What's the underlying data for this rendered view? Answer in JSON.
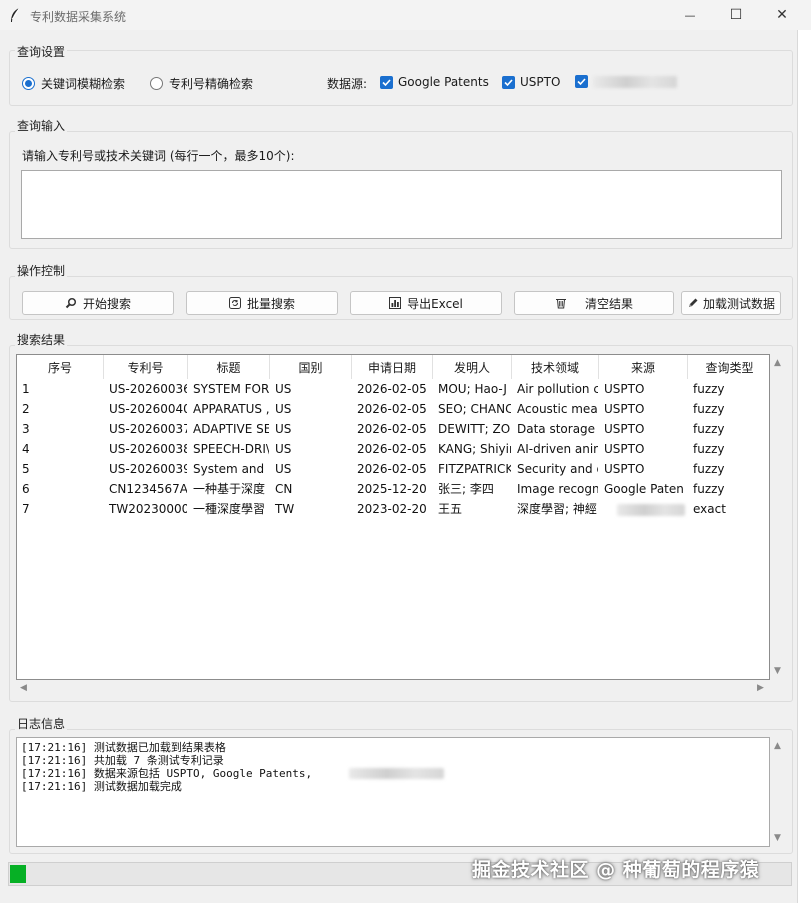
{
  "window": {
    "title": "专利数据采集系统",
    "minimize_glyph": "—",
    "maximize_glyph": "☐",
    "close_glyph": "✕"
  },
  "query_settings": {
    "legend": "查询设置",
    "mode_fuzzy": "关键词模糊检索",
    "mode_exact": "专利号精确检索",
    "selected_mode": "fuzzy",
    "sources_label": "数据源:",
    "sources": [
      {
        "label": "Google Patents",
        "checked": true
      },
      {
        "label": "USPTO",
        "checked": true
      },
      {
        "label": "",
        "checked": true,
        "redacted": true
      }
    ]
  },
  "query_input": {
    "legend": "查询输入",
    "prompt": "请输入专利号或技术关键词 (每行一个，最多10个):",
    "value": ""
  },
  "controls": {
    "legend": "操作控制",
    "buttons": [
      {
        "label": "开始搜索",
        "icon": "search-icon"
      },
      {
        "label": "批量搜索",
        "icon": "refresh-icon"
      },
      {
        "label": "导出Excel",
        "icon": "chart-icon"
      },
      {
        "label": "清空结果",
        "icon": "trash-icon"
      },
      {
        "label": "加载测试数据",
        "icon": "pencil-icon"
      }
    ]
  },
  "results": {
    "legend": "搜索结果",
    "columns": [
      "序号",
      "专利号",
      "标题",
      "国别",
      "申请日期",
      "发明人",
      "技术领域",
      "来源",
      "查询类型"
    ],
    "rows": [
      [
        "1",
        "US-20260036",
        "SYSTEM FOR",
        "US",
        "2026-02-05",
        "MOU; Hao-J",
        "Air pollution c",
        "USPTO",
        "fuzzy"
      ],
      [
        "2",
        "US-20260040",
        "APPARATUS ,",
        "US",
        "2026-02-05",
        "SEO; CHANC",
        "Acoustic meas",
        "USPTO",
        "fuzzy"
      ],
      [
        "3",
        "US-20260037",
        "ADAPTIVE SE",
        "US",
        "2026-02-05",
        "DEWITT; ZO",
        "Data storage (",
        "USPTO",
        "fuzzy"
      ],
      [
        "4",
        "US-20260038",
        "SPEECH-DRI\\",
        "US",
        "2026-02-05",
        "KANG; Shiyir",
        "AI-driven anim",
        "USPTO",
        "fuzzy"
      ],
      [
        "5",
        "US-20260039",
        "System and I",
        "US",
        "2026-02-05",
        "FITZPATRICK",
        "Security and d",
        "USPTO",
        "fuzzy"
      ],
      [
        "6",
        "CN1234567A",
        "一种基于深度",
        "CN",
        "2025-12-20",
        "张三; 李四",
        "Image recogn",
        "Google Paten",
        "fuzzy"
      ],
      [
        "7",
        "TW20230000",
        "一種深度學習",
        "TW",
        "2023-02-20",
        "王五",
        "深度學習; 神經",
        "",
        "exact"
      ]
    ]
  },
  "log": {
    "legend": "日志信息",
    "lines": [
      "[17:21:16] 测试数据已加载到结果表格",
      "[17:21:16] 共加载 7 条测试专利记录",
      "[17:21:16] 数据来源包括 USPTO, Google Patents,",
      "[17:21:16] 测试数据加载完成"
    ]
  },
  "progress": {
    "value": 0.02,
    "color": "#06b025"
  },
  "watermark": "掘金技术社区 @ 种葡萄的程序猿",
  "colors": {
    "accent": "#1a6fcf",
    "progress": "#06b025"
  }
}
